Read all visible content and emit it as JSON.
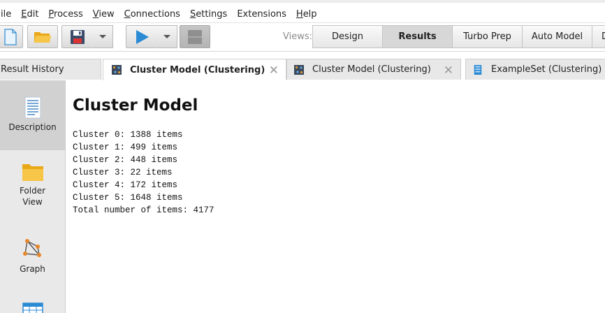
{
  "menu": {
    "items": [
      {
        "u": "",
        "rest": "ile"
      },
      {
        "u": "E",
        "rest": "dit"
      },
      {
        "u": "P",
        "rest": "rocess"
      },
      {
        "u": "V",
        "rest": "iew"
      },
      {
        "u": "C",
        "rest": "onnections"
      },
      {
        "u": "S",
        "rest": "ettings"
      },
      {
        "u": "",
        "rest": "Extensions"
      },
      {
        "u": "H",
        "rest": "elp"
      }
    ]
  },
  "toolbar": {
    "views_label": "Views:",
    "views": [
      "Design",
      "Results",
      "Turbo Prep",
      "Auto Model",
      "D"
    ],
    "active_view": "Results"
  },
  "tabs": [
    {
      "label": "Result History",
      "active": false,
      "icon": "none"
    },
    {
      "label": "Cluster Model (Clustering)",
      "active": true,
      "icon": "cluster-icon",
      "closable": true
    },
    {
      "label": "Cluster Model (Clustering)",
      "active": false,
      "icon": "cluster-icon",
      "closable": true
    },
    {
      "label": "ExampleSet (Clustering)",
      "active": false,
      "icon": "table-icon"
    }
  ],
  "close_glyph": "✕",
  "sidebar": {
    "items": [
      {
        "label": "Description",
        "icon": "document-icon",
        "selected": true
      },
      {
        "label": "Folder\nView",
        "icon": "folder-icon",
        "selected": false
      },
      {
        "label": "Graph",
        "icon": "graph-icon",
        "selected": false
      }
    ]
  },
  "main": {
    "title": "Cluster Model",
    "lines": [
      "Cluster 0: 1388 items",
      "Cluster 1: 499 items",
      "Cluster 2: 448 items",
      "Cluster 3: 22 items",
      "Cluster 4: 172 items",
      "Cluster 5: 1648 items",
      "Total number of items: 4177"
    ]
  },
  "colors": {
    "accent_blue": "#2a8ad4",
    "folder_yellow": "#f5b935",
    "graph_orange": "#e8862a"
  }
}
